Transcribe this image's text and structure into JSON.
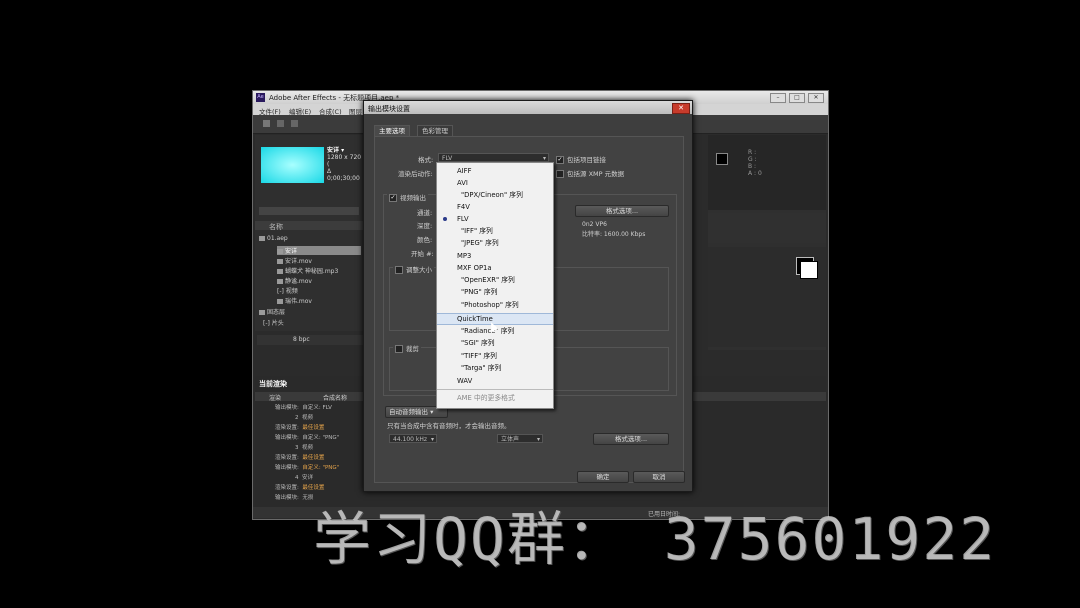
{
  "ae": {
    "title": "Adobe After Effects - 无标题项目.aep *",
    "menu": [
      "文件(F)",
      "编辑(E)",
      "合成(C)",
      "图层"
    ],
    "project": {
      "comp_name": "安详 ▾",
      "comp_size": "1280 x 720 (",
      "comp_time": "Δ 0;00;30;00",
      "col_name": "名称",
      "items": [
        "01.aep",
        "安详",
        "安详.mov",
        "蝴蝶犬 神秘园.mp3",
        "静谧.mov",
        "[-] 视频",
        "瑞伟.mov",
        "固态层",
        "[-] 片头"
      ],
      "bpc": "8 bpc"
    },
    "render_queue": {
      "title": "当前渲染",
      "head_render": "渲染",
      "head_comp": "合成名称",
      "rows": [
        {
          "a": "输出模块:",
          "b": "自定义: FLV"
        },
        {
          "a": "2",
          "b": "视频"
        },
        {
          "a": "渲染设置:",
          "b": "最佳设置"
        },
        {
          "a": "输出模块:",
          "b": "自定义: \"PNG\""
        },
        {
          "a": "3",
          "b": "视频"
        },
        {
          "a": "渲染设置:",
          "b": "最佳设置"
        },
        {
          "a": "输出模块:",
          "b": "自定义: \"PNG\""
        },
        {
          "a": "4",
          "b": "安详"
        },
        {
          "a": "渲染设置:",
          "b": "最佳设置"
        },
        {
          "a": "输出模块:",
          "b": "无损"
        }
      ],
      "status_right": "已用日时间:"
    },
    "right_panel": {
      "info1": "R :",
      "info2": "G :",
      "info3": "B :",
      "info4": "A : 0"
    }
  },
  "dialog": {
    "title": "输出模块设置",
    "tabs": [
      "主要选项",
      "色彩管理"
    ],
    "format_label": "格式:",
    "format_value": "FLV",
    "post_render_label": "渲染后动作:",
    "include_project_link": "包括项目链接",
    "include_xmp": "包括源 XMP 元数据",
    "video_output": "视频输出",
    "channels": "通道:",
    "depth": "深度:",
    "color": "颜色:",
    "start": "开始 #:",
    "codec_info": "0n2 VP6",
    "bitrate_info": "比特率: 1600.00 Kbps",
    "format_options": "格式选项...",
    "resize": "调整大小",
    "crop": "裁剪",
    "audio_output": "自动音频输出 ▾",
    "audio_note": "只有当合成中含有音频时，才会输出音频。",
    "sample_rate": "44.100 kHz",
    "stereo": "立体声",
    "audio_format_options": "格式选项...",
    "ok": "确定",
    "cancel": "取消"
  },
  "format_list": {
    "selected": "FLV",
    "hovered": "QuickTime",
    "items": [
      "AIFF",
      "AVI",
      "\"DPX/Cineon\" 序列",
      "F4V",
      "FLV",
      "\"IFF\" 序列",
      "\"JPEG\" 序列",
      "MP3",
      "MXF OP1a",
      "\"OpenEXR\" 序列",
      "\"PNG\" 序列",
      "\"Photoshop\" 序列",
      "QuickTime",
      "\"Radiance\" 序列",
      "\"SGI\" 序列",
      "\"TIFF\" 序列",
      "\"Targa\" 序列",
      "WAV"
    ],
    "footer": "AME 中的更多格式"
  },
  "watermark": "学习QQ群： 375601922",
  "colors": {
    "selection_dot": "#2b3b8a",
    "hover_row": "#dbe6f4",
    "comp_thumb": "#19d8e6",
    "close_red": "#c73b2b"
  }
}
